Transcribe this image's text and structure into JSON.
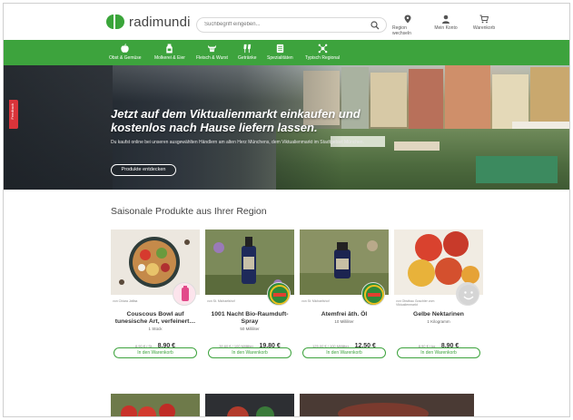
{
  "header": {
    "brand": "radimundi",
    "search_placeholder": "Suchbegriff eingeben...",
    "actions": [
      {
        "label": "Region wechseln",
        "icon": "map-pin-icon"
      },
      {
        "label": "Mein Konto",
        "icon": "user-icon"
      },
      {
        "label": "Warenkorb",
        "icon": "cart-icon"
      }
    ]
  },
  "categories": [
    {
      "label": "Obst & Gemüse",
      "icon": "apple-icon"
    },
    {
      "label": "Molkerei & Eier",
      "icon": "milk-icon"
    },
    {
      "label": "Fleisch & Wurst",
      "icon": "cow-icon"
    },
    {
      "label": "Getränke",
      "icon": "drinks-icon"
    },
    {
      "label": "Spezialitäten",
      "icon": "specialties-icon"
    },
    {
      "label": "Typisch Regional",
      "icon": "regional-icon"
    }
  ],
  "hero": {
    "title": "Jetzt auf dem Viktualienmarkt einkaufen und kostenlos nach Hause liefern lassen.",
    "subtitle": "Du kaufst online bei unseren ausgewählten Händlern am alten Herz Münchens, dem Viktualienmarkt im Stadtgebiet München.",
    "button": "Produkte entdecken",
    "side_tab": "Feedback"
  },
  "section": {
    "title": "Saisonale Produkte aus Ihrer Region"
  },
  "products": [
    {
      "vendor": "von Chiara Jaffaa",
      "name_line1": "Couscous Bowl auf",
      "name_line2": "tunesische Art, verfeinert…",
      "qty": "1 Stück",
      "unit": "8,90 € / St",
      "price": "8,90 €",
      "button": "In den Warenkorb"
    },
    {
      "vendor": "von St. Michaelshof",
      "name_line1": "1001 Nacht Bio-Raumduft-",
      "name_line2": "Spray",
      "qty": "50 Milliliter",
      "unit": "39,60 € / 100 Milliliter",
      "price": "19,80 €",
      "button": "In den Warenkorb"
    },
    {
      "vendor": "von St. Michaelshof",
      "name_line1": "Atemfrei äth. Öl",
      "name_line2": "",
      "qty": "10 Milliliter",
      "unit": "125,00 € / 100 Milliliter",
      "price": "12,50 €",
      "button": "In den Warenkorb"
    },
    {
      "vendor": "von Obstbau Goschler vom Viktualienmarkt",
      "name_line1": "Gelbe Nektarinen",
      "name_line2": "",
      "qty": "1 Kilogramm",
      "unit": "8,90 € / kg",
      "price": "8,90 €",
      "button": "In den Warenkorb"
    }
  ],
  "colors": {
    "brand_green": "#3da33d",
    "feedback_red": "#d9343a"
  }
}
